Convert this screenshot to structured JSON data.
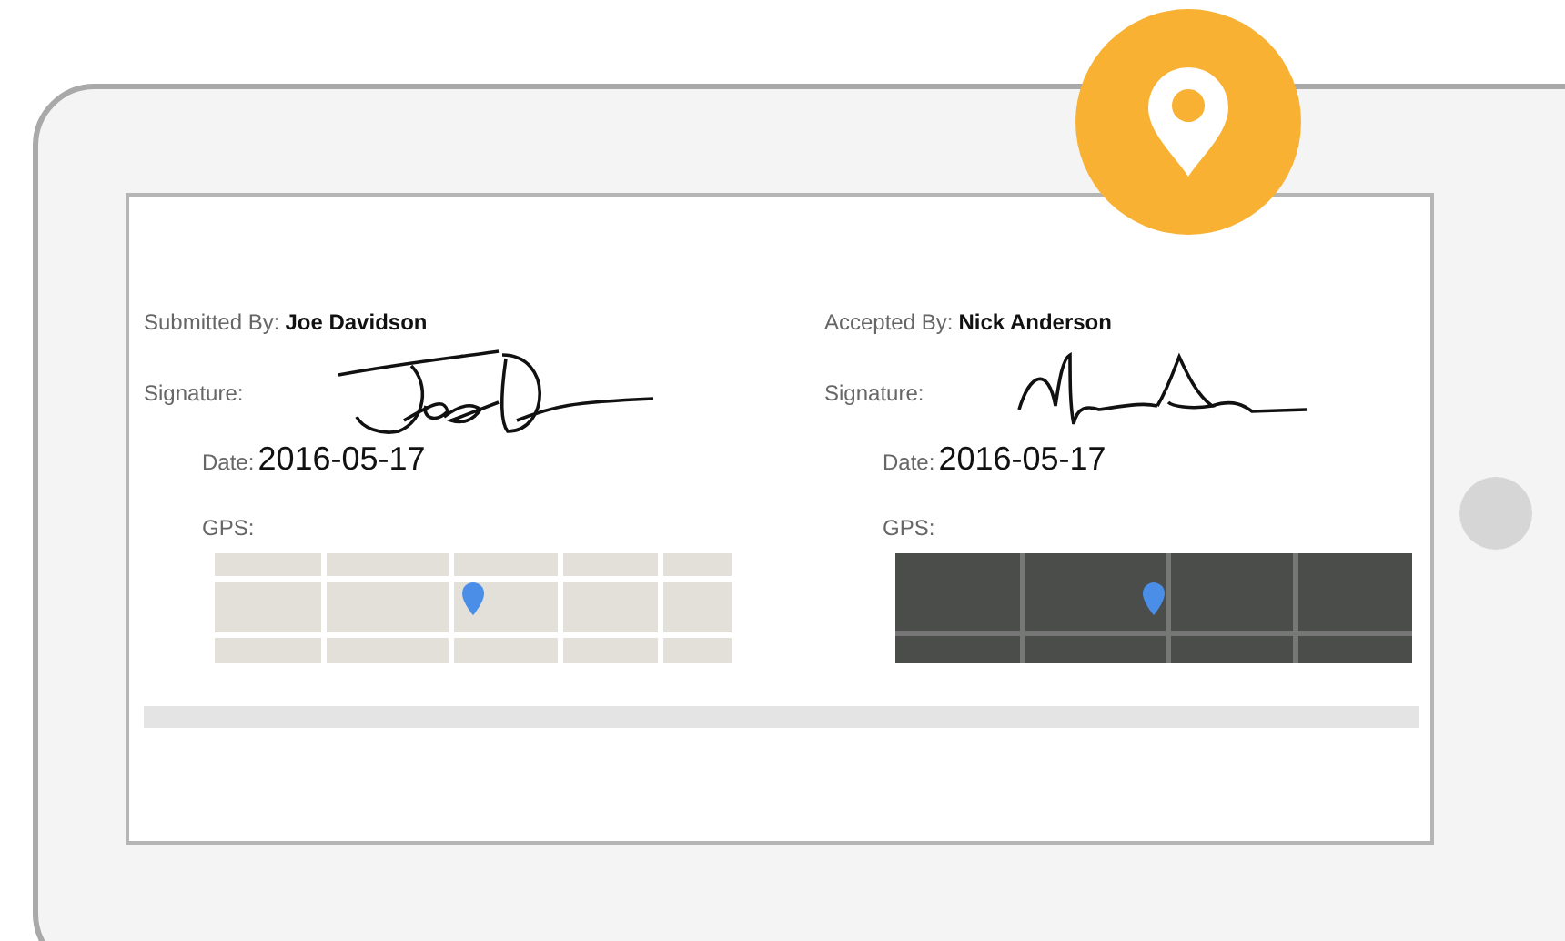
{
  "document": {
    "parties": [
      {
        "by_label": "Submitted By:",
        "name": "Joe Davidson",
        "signature_label": "Signature:",
        "date_label": "Date:",
        "date": "2016-05-17",
        "gps_label": "GPS:",
        "map": {
          "kind": "street"
        }
      },
      {
        "by_label": "Accepted By:",
        "name": "Nick Anderson",
        "signature_label": "Signature:",
        "date_label": "Date:",
        "date": "2016-05-17",
        "gps_label": "GPS:",
        "map": {
          "kind": "satellite"
        }
      }
    ]
  }
}
